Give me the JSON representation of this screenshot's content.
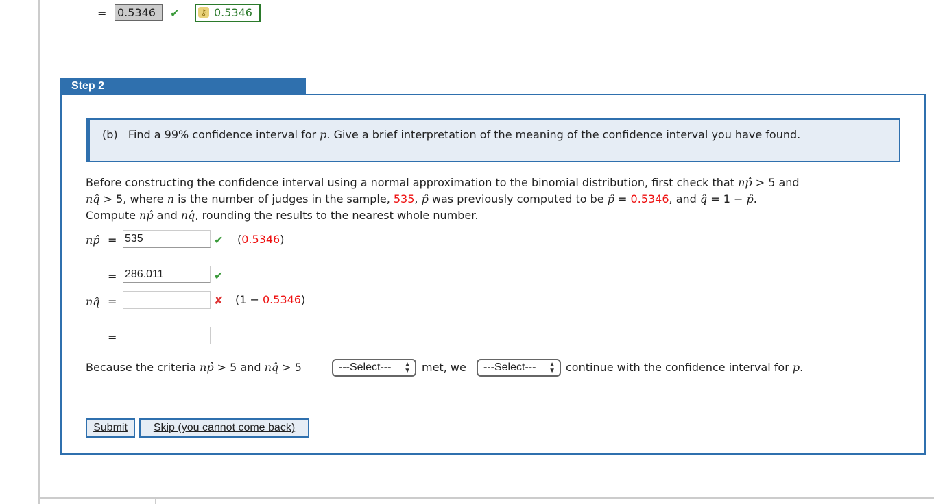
{
  "prev_step": {
    "eq": "=",
    "student_answer": "0.5346",
    "key_answer": "0.5346",
    "key_icon": "key-icon"
  },
  "step": {
    "header": "Step 2",
    "question": {
      "part": "(b)",
      "text_a": "Find a 99% confidence interval for ",
      "var_p": "p",
      "text_b": ". Give a brief interpretation of the meaning of the confidence interval you have found."
    },
    "para": {
      "l1a": "Before constructing the confidence interval using a normal approximation to the binomial distribution, first check that ",
      "np": "np̂",
      "l1b": " > 5 and",
      "nq": "nq̂",
      "l2a": " > 5, where ",
      "n": "n",
      "l2b": " is the number of judges in the sample, ",
      "n_val": "535",
      "l2c": ", ",
      "phat": "p̂",
      "l2d": " was previously computed to be ",
      "phat2": "p̂",
      "l2e": " = ",
      "phat_val": "0.5346",
      "l2f": ", and ",
      "qhat": "q̂",
      "l2g": " = 1 − ",
      "phat3": "p̂",
      "l2h": ".",
      "l3a": "Compute ",
      "np2": "np̂",
      "l3b": " and ",
      "nq2": "nq̂",
      "l3c": ", rounding the results to the nearest whole number."
    },
    "np_row": {
      "label": "np̂",
      "eq": "=",
      "value": "535",
      "hint_open": "(",
      "hint_val": "0.5346",
      "hint_close": ")"
    },
    "np_row2": {
      "eq": "=",
      "value": "286.011"
    },
    "nq_row": {
      "label": "nq̂",
      "eq": "=",
      "value": "",
      "hint_a": "(1 − ",
      "hint_val": "0.5346",
      "hint_close": ")"
    },
    "nq_row2": {
      "eq": "=",
      "value": ""
    },
    "criteria": {
      "a": "Because the criteria ",
      "np": "np̂",
      "b": " > 5 and ",
      "nq": "nq̂",
      "c": " > 5",
      "select1": "---Select---",
      "d": "met, we",
      "select2": "---Select---",
      "e": "continue with the confidence interval for ",
      "p": "p",
      "f": "."
    },
    "buttons": {
      "submit": "Submit",
      "skip": "Skip (you cannot come back)"
    }
  }
}
